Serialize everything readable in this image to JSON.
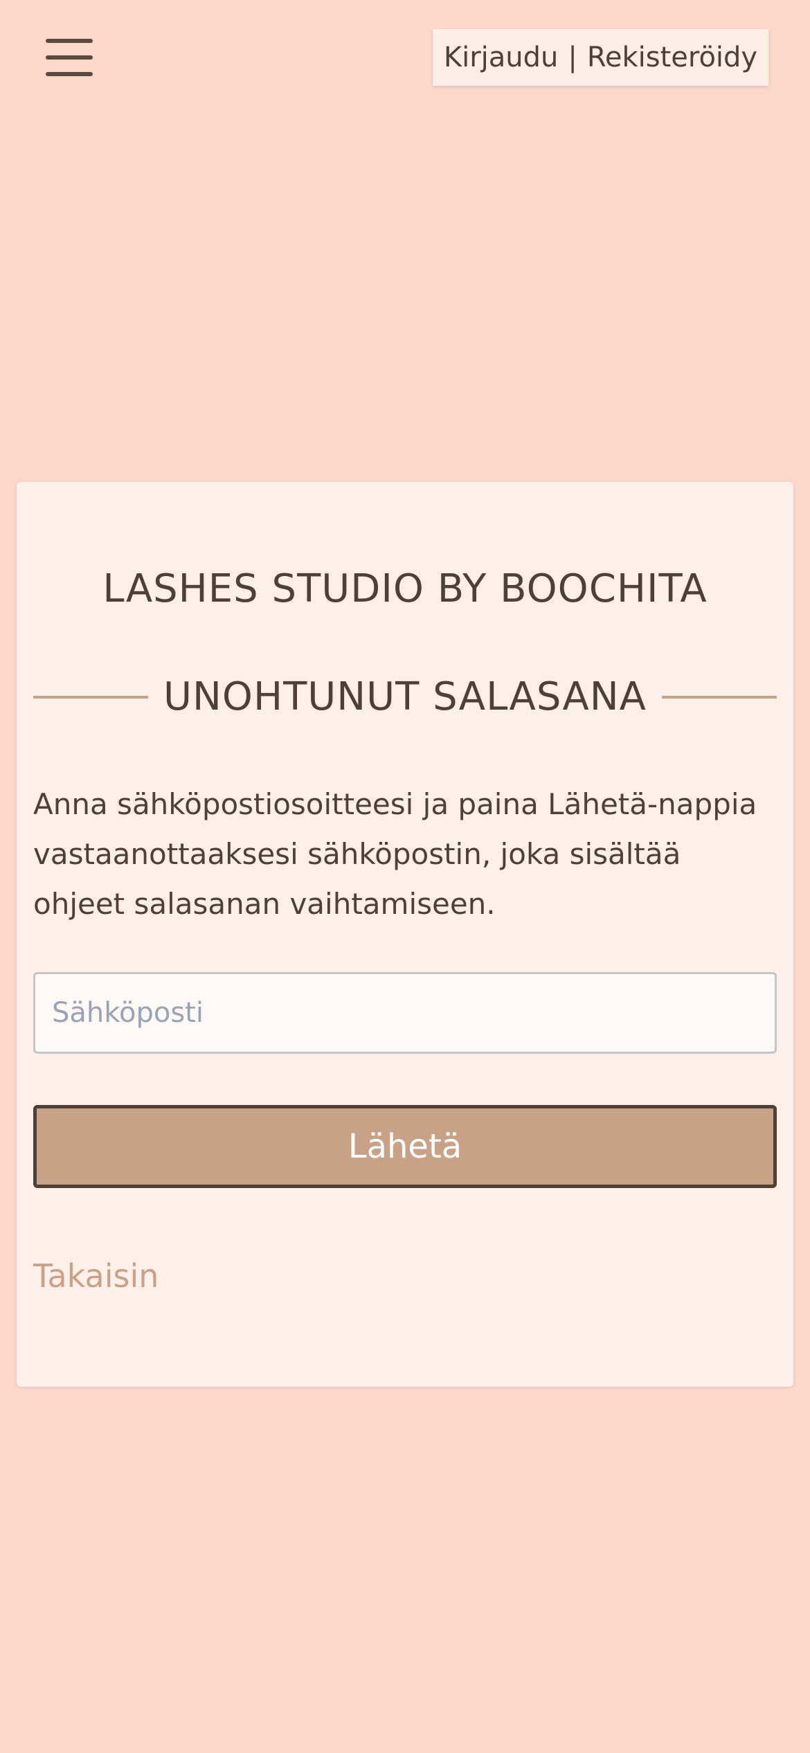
{
  "header": {
    "menu_icon": "hamburger-menu-icon",
    "login_label": "Kirjaudu",
    "separator": "|",
    "register_label": "Rekisteröidy"
  },
  "card": {
    "studio_name": "LASHES STUDIO BY BOOCHITA",
    "heading": "UNOHTUNUT SALASANA",
    "instructions": "Anna sähköpostiosoitteesi ja paina Lähetä-nappia vastaanottaaksesi sähköpostin, joka sisältää ohjeet salasanan vaihtamiseen.",
    "email": {
      "value": "",
      "placeholder": "Sähköposti"
    },
    "submit_label": "Lähetä",
    "back_label": "Takaisin"
  },
  "colors": {
    "page_background": "#fcd8ca",
    "card_background": "#fdefea",
    "accent": "#c8a287",
    "text": "#4e4038",
    "placeholder": "#9aa3b3"
  }
}
